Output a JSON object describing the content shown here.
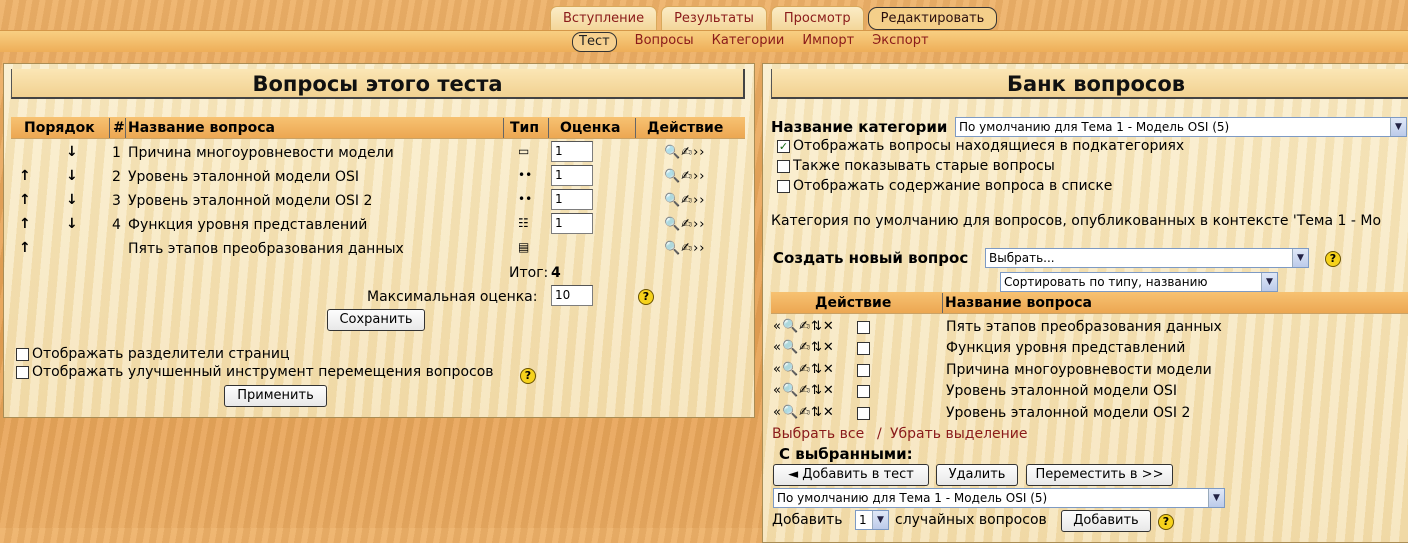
{
  "tabs": {
    "top": [
      {
        "label": "Вступление",
        "selected": false
      },
      {
        "label": "Результаты",
        "selected": false
      },
      {
        "label": "Просмотр",
        "selected": false
      },
      {
        "label": "Редактировать",
        "selected": true
      }
    ],
    "sub": [
      {
        "label": "Тест",
        "selected": true
      },
      {
        "label": "Вопросы",
        "selected": false
      },
      {
        "label": "Категории",
        "selected": false
      },
      {
        "label": "Импорт",
        "selected": false
      },
      {
        "label": "Экспорт",
        "selected": false
      }
    ]
  },
  "left": {
    "title": "Вопросы этого теста",
    "columns": {
      "order": "Порядок",
      "num": "#",
      "name": "Название вопроса",
      "type": "Тип",
      "grade": "Оценка",
      "action": "Действие"
    },
    "questions": [
      {
        "up": "",
        "down": "↓",
        "num": "1",
        "name": "Причина многоуровневости модели",
        "type_icon": "▭",
        "grade": "1",
        "actions": "🔍✍››"
      },
      {
        "up": "↑",
        "down": "↓",
        "num": "2",
        "name": "Уровень эталонной модели OSI",
        "type_icon": "••",
        "grade": "1",
        "actions": "🔍✍››"
      },
      {
        "up": "↑",
        "down": "↓",
        "num": "3",
        "name": "Уровень эталонной модели OSI 2",
        "type_icon": "••",
        "grade": "1",
        "actions": "🔍✍››"
      },
      {
        "up": "↑",
        "down": "↓",
        "num": "4",
        "name": "Функция уровня представлений",
        "type_icon": "☷",
        "grade": "1",
        "actions": "🔍✍››"
      },
      {
        "up": "↑",
        "down": "",
        "num": "",
        "name": "Пять этапов преобразования данных",
        "type_icon": "▤",
        "grade": null,
        "actions": "🔍✍››"
      }
    ],
    "total_label": "Итог:",
    "total_value": "4",
    "max_grade_label": "Максимальная оценка:",
    "max_grade_value": "10",
    "save_label": "Сохранить",
    "show_page_breaks": "Отображать разделители страниц",
    "show_reorder_tool": "Отображать улучшенный инструмент перемещения вопросов",
    "apply_label": "Применить"
  },
  "right": {
    "title": "Банк вопросов",
    "category_label": "Название категории",
    "category_value": "По умолчанию для Тема 1 - Модель OSI (5)",
    "opt_subcats": "Отображать вопросы находящиеся в подкатегориях",
    "opt_subcats_checked": true,
    "opt_old": "Также показывать старые вопросы",
    "opt_old_checked": false,
    "opt_content": "Отображать содержание вопроса в списке",
    "opt_content_checked": false,
    "category_info": "Категория по умолчанию для вопросов, опубликованных в контексте 'Тема 1 - Мо",
    "create_label": "Создать новый вопрос",
    "create_value": "Выбрать...",
    "sort_value": "Сортировать по типу, названию",
    "col_action": "Действие",
    "col_name": "Название вопроса",
    "bank": [
      {
        "actions": "«🔍✍⇅✕",
        "name": "Пять этапов преобразования данных"
      },
      {
        "actions": "«🔍✍⇅✕",
        "name": "Функция уровня представлений"
      },
      {
        "actions": "«🔍✍⇅✕",
        "name": "Причина многоуровневости модели"
      },
      {
        "actions": "«🔍✍⇅✕",
        "name": "Уровень эталонной модели OSI"
      },
      {
        "actions": "«🔍✍⇅✕",
        "name": "Уровень эталонной модели OSI 2"
      }
    ],
    "select_all": "Выбрать все",
    "separator": "/",
    "deselect_all": "Убрать выделение",
    "with_selected": "С выбранными:",
    "add_to_test": "◄ Добавить в тест",
    "delete": "Удалить",
    "move_to": "Переместить в >>",
    "move_target": "По умолчанию для Тема 1 - Модель OSI (5)",
    "add_label": "Добавить",
    "random_count": "1",
    "random_suffix": "случайных вопросов",
    "add_button": "Добавить"
  },
  "icons": {
    "help": "help-icon",
    "up": "arrow-up-icon",
    "down": "arrow-down-icon"
  }
}
